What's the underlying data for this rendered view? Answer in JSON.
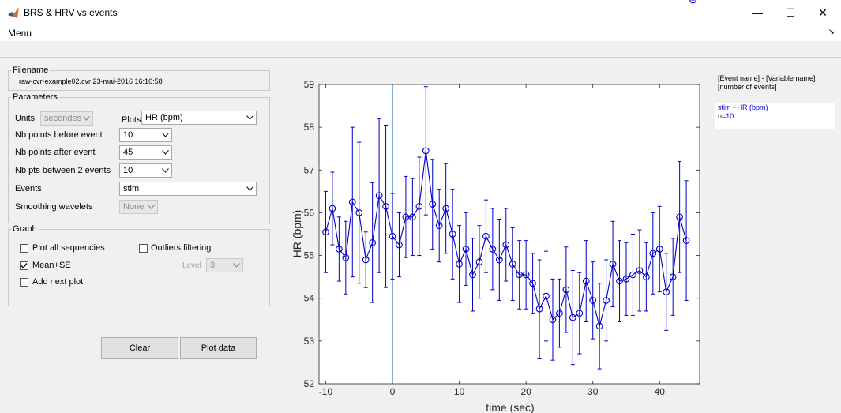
{
  "window": {
    "title": "BRS & HRV vs events",
    "min_glyph": "—",
    "max_glyph": "☐",
    "close_glyph": "✕"
  },
  "menu": {
    "label": "Menu",
    "arrow": "↘"
  },
  "filename": {
    "legend": "Filename",
    "value": "raw-cvr-example02.cvr   23-mai-2016 16:10:58"
  },
  "parameters": {
    "legend": "Parameters",
    "units_label": "Units",
    "units_value": "secondes",
    "plots_label": "Plots",
    "plots_value": "HR (bpm)",
    "before_label": "Nb points before event",
    "before_value": "10",
    "after_label": "Nb points after event",
    "after_value": "45",
    "between_label": "Nb pts between 2 events",
    "between_value": "10",
    "events_label": "Events",
    "events_value": "stim",
    "smoothing_label": "Smoothing wavelets",
    "smoothing_value": "None"
  },
  "graph": {
    "legend": "Graph",
    "plot_all_label": "Plot all sequencies",
    "plot_all_checked": false,
    "outliers_label": "Outliers filtering",
    "outliers_checked": false,
    "mean_se_label": "Mean+SE",
    "mean_se_checked": true,
    "add_next_label": "Add next plot",
    "add_next_checked": false,
    "level_label": "Level",
    "level_value": "3"
  },
  "buttons": {
    "clear": "Clear",
    "plot": "Plot data"
  },
  "info": {
    "header_line1": "[Event name] - [Variable name]",
    "header_line2": "[number of events]",
    "entry_line1": "stim - HR (bpm)",
    "entry_line2": "n=10"
  },
  "colors": {
    "series": "#0000c8",
    "event_line": "#2a7fbf",
    "axis": "#262626"
  },
  "chart_data": {
    "type": "line",
    "xlabel": "time (sec)",
    "ylabel": "HR (bpm)",
    "xlim": [
      -11,
      46
    ],
    "ylim": [
      52,
      59
    ],
    "xticks": [
      -10,
      0,
      10,
      20,
      30,
      40
    ],
    "yticks": [
      52,
      53,
      54,
      55,
      56,
      57,
      58,
      59
    ],
    "event_marker_x": 0,
    "error_bars": "mean ± SE",
    "x": [
      -10,
      -9,
      -8,
      -7,
      -6,
      -5,
      -4,
      -3,
      -2,
      -1,
      0,
      1,
      2,
      3,
      4,
      5,
      6,
      7,
      8,
      9,
      10,
      11,
      12,
      13,
      14,
      15,
      16,
      17,
      18,
      19,
      20,
      21,
      22,
      23,
      24,
      25,
      26,
      27,
      28,
      29,
      30,
      31,
      32,
      33,
      34,
      35,
      36,
      37,
      38,
      39,
      40,
      41,
      42,
      43,
      44,
      45
    ],
    "y": [
      55.55,
      56.1,
      55.15,
      54.95,
      56.25,
      56.0,
      54.9,
      55.3,
      56.4,
      56.15,
      55.45,
      55.25,
      55.9,
      55.9,
      56.15,
      57.45,
      56.2,
      55.7,
      56.1,
      55.5,
      54.8,
      55.15,
      54.55,
      54.85,
      55.45,
      55.15,
      54.9,
      55.25,
      54.8,
      54.55,
      54.55,
      54.35,
      53.75,
      54.05,
      53.5,
      53.65,
      54.2,
      53.55,
      53.65,
      54.4,
      53.95,
      53.35,
      53.95,
      54.8,
      54.4,
      54.45,
      54.55,
      54.65,
      54.5,
      55.05,
      55.15,
      54.15,
      54.5,
      55.9,
      55.35
    ],
    "err": [
      0.95,
      0.85,
      0.75,
      0.85,
      1.75,
      1.65,
      0.65,
      1.4,
      1.8,
      1.9,
      1.0,
      0.75,
      0.95,
      0.9,
      1.15,
      1.5,
      1.05,
      0.85,
      1.05,
      1.05,
      0.9,
      0.85,
      0.85,
      0.85,
      0.85,
      0.95,
      0.95,
      0.85,
      0.85,
      0.8,
      0.8,
      0.7,
      1.15,
      1.05,
      0.95,
      0.8,
      1.0,
      1.1,
      0.95,
      0.95,
      0.9,
      1.0,
      0.95,
      1.0,
      0.95,
      0.85,
      0.95,
      0.95,
      0.8,
      0.95,
      1.0,
      0.9,
      0.9,
      1.3,
      1.4
    ]
  }
}
